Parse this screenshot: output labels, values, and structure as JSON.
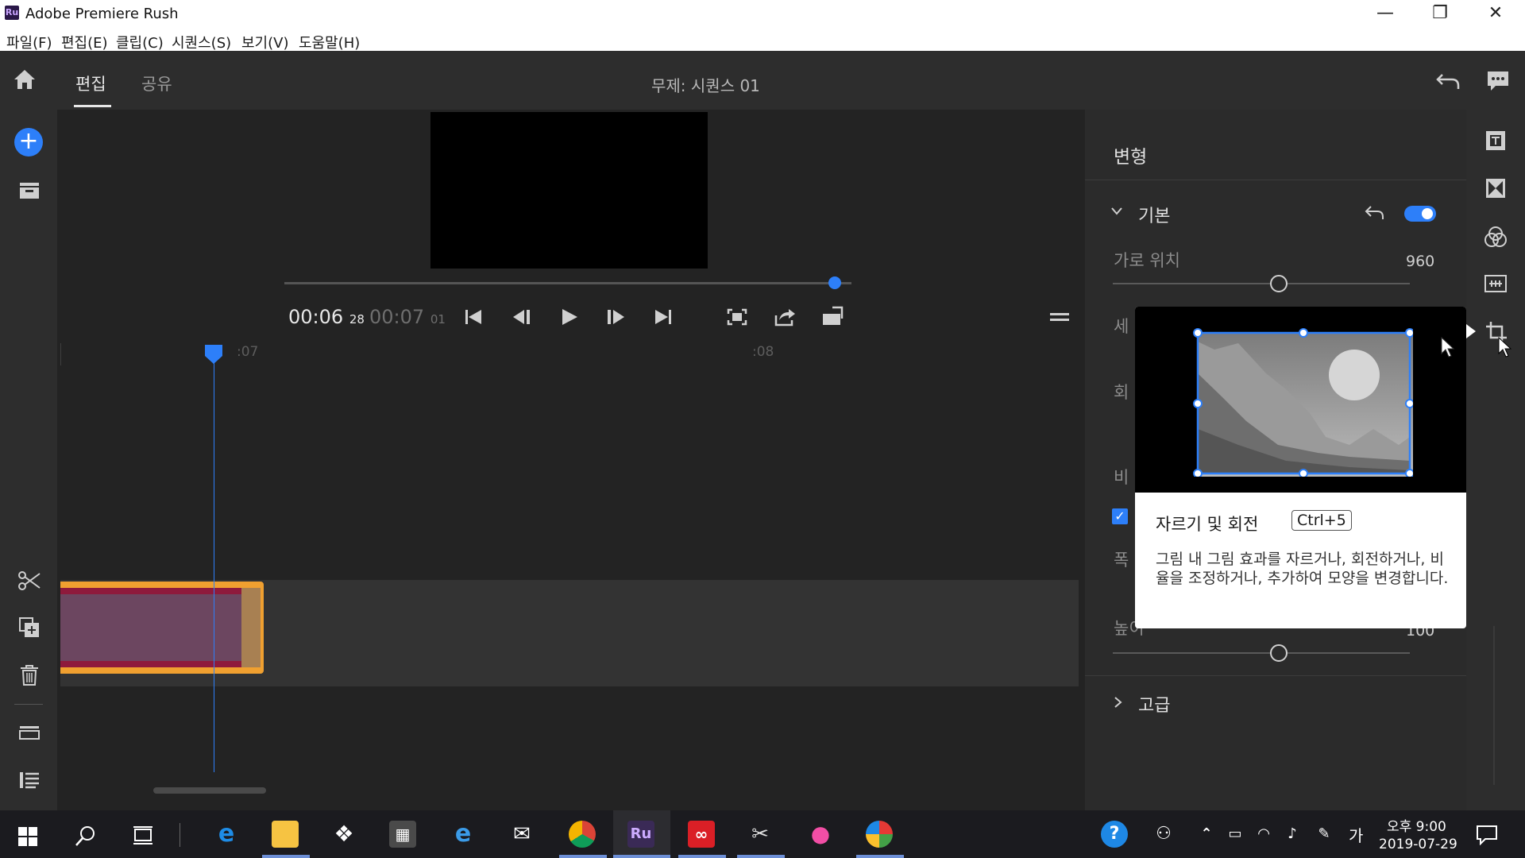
{
  "window": {
    "app_icon": "Ru",
    "title": "Adobe Premiere Rush",
    "min_glyph": "—",
    "max_glyph": "❐",
    "close_glyph": "✕"
  },
  "menu": [
    {
      "label": "파일(F)"
    },
    {
      "label": "편집(E)"
    },
    {
      "label": "클립(C)"
    },
    {
      "label": "시퀀스(S)"
    },
    {
      "label": "보기(V)"
    },
    {
      "label": "도움말(H)"
    }
  ],
  "header": {
    "tabs": [
      {
        "label": "편집"
      },
      {
        "label": "공유"
      }
    ],
    "sequence_title": "무제: 시퀀스 01"
  },
  "player": {
    "current_time": "00:06",
    "current_frames": "28",
    "total_time": "00:07",
    "total_frames": "01",
    "scrub_progress": 0.97
  },
  "timeline": {
    "ruler_labels": [
      ":07",
      ":08"
    ]
  },
  "panel": {
    "title": "변형",
    "section_basic": "기본",
    "basic_enabled": true,
    "horizontal_position_label": "가로 위치",
    "horizontal_position_value": "960",
    "height_label": "높이",
    "height_value": "100",
    "section_advanced": "고급",
    "obscured_labels": [
      "세",
      "회",
      "비",
      "폭"
    ]
  },
  "tooltip": {
    "title": "자르기 및 회전",
    "shortcut": "Ctrl+5",
    "description": "그림 내 그림 효과를 자르거나, 회전하거나, 비율을 조정하거나, 추가하여 모양을 변경합니다."
  },
  "taskbar": {
    "clock_time": "오후 9:00",
    "clock_date": "2019-07-29",
    "ime": "가"
  },
  "colors": {
    "accent_blue": "#2d7ff9",
    "clip_orange": "#f0a030",
    "clip_red": "#8e1a3c",
    "panel_bg": "#2b2b2b"
  }
}
